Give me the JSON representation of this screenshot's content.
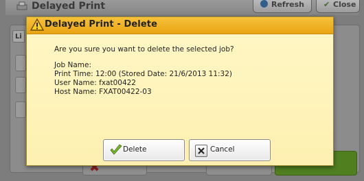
{
  "background": {
    "title": "Delayed Print",
    "refresh_label": "Refresh",
    "close_label": "Close",
    "tab_label": "Li"
  },
  "dialog": {
    "title": "Delayed Print - Delete",
    "question": "Are you sure you want to delete the selected job?",
    "job_name": "Job Name:",
    "print_time": "Print Time: 12:00 (Stored Date: 21/6/2013 11:32)",
    "user_name": "User Name: fxat00422",
    "host_name": "Host Name: FXAT00422-03",
    "delete_label": "Delete",
    "cancel_label": "Cancel"
  },
  "colors": {
    "dialog_header": "#f2b52b",
    "dialog_body": "#fff6c4",
    "background_dim": "#7d7d7d"
  }
}
